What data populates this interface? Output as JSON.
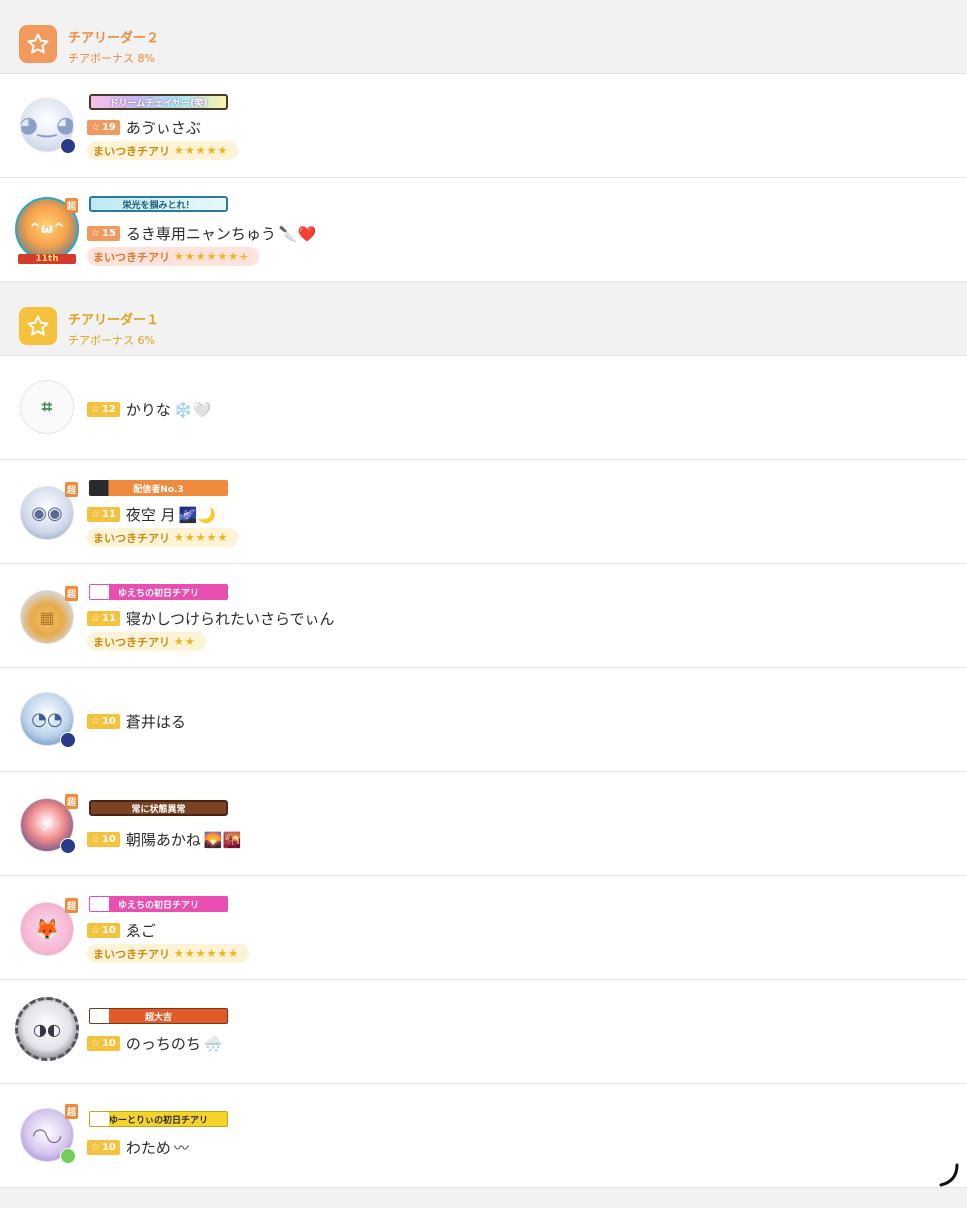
{
  "sections": [
    {
      "title": "チアリーダー２",
      "bonus": "チアボーナス 8%",
      "color": "#f29a5e",
      "icon": "star-icon",
      "members": [
        {
          "name": "あゔぃさぶ",
          "level": "19",
          "banner": "ドリームチェイサー(笑)",
          "tag": "まいつきチアリ",
          "tag_stars": "★★★★★",
          "chou": ""
        },
        {
          "name": "るき専用ニャンちゅう",
          "emoji": "🔪❤️",
          "level": "15",
          "banner": "栄光を掴みとれ！",
          "avatar_text": "11th",
          "tag": "まいつきチアリ",
          "tag_stars": "★★★★★★+",
          "chou": "超"
        }
      ]
    },
    {
      "title": "チアリーダー１",
      "bonus": "チアボーナス 6%",
      "color": "#f5c23d",
      "icon": "star-icon",
      "members": [
        {
          "name": "かりな",
          "emoji": "❄️🤍",
          "level": "12",
          "chou": ""
        },
        {
          "name": "夜空 月",
          "emoji": "🌌🌙",
          "level": "11",
          "banner": "配信者No.3",
          "tag": "まいつきチアリ",
          "tag_stars": "★★★★★",
          "chou": "超"
        },
        {
          "name": "寝かしつけられたいさらでぃん",
          "level": "11",
          "banner": "ゆえちの初日チアリ",
          "tag": "まいつきチアリ",
          "tag_stars": "★★",
          "chou": "超"
        },
        {
          "name": "蒼井はる",
          "level": "10",
          "chou": ""
        },
        {
          "name": "朝陽あかね",
          "emoji": "🌄🌇",
          "level": "10",
          "banner": "常に状態異常",
          "chou": "超"
        },
        {
          "name": "ゑご",
          "level": "10",
          "banner": "ゆえちの初日チアリ",
          "tag": "まいつきチアリ",
          "tag_stars": "★★★★★★",
          "chou": "超"
        },
        {
          "name": "のっちのち",
          "emoji": "🌨️",
          "level": "10",
          "banner": "超大吉",
          "chou": ""
        },
        {
          "name": "わため",
          "emoji": "〰",
          "level": "10",
          "banner": "ゆーとりぃの初日チアリ",
          "chou": "超"
        }
      ]
    }
  ],
  "level_star": "☆"
}
